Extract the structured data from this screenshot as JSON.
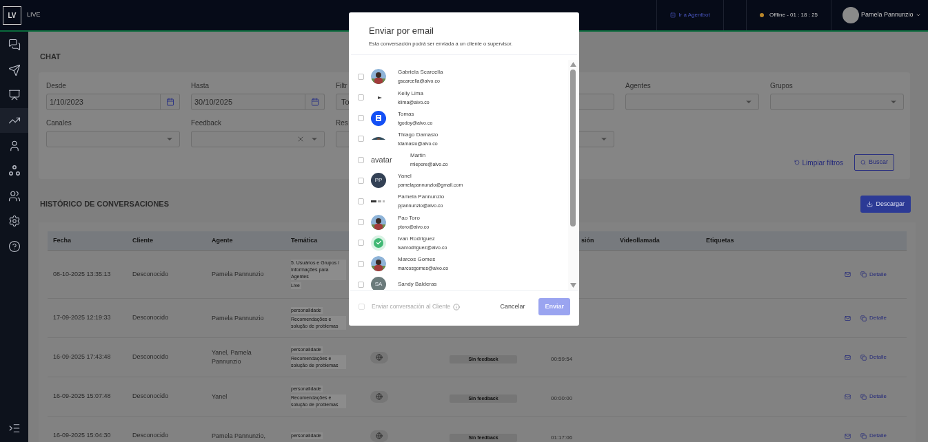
{
  "header": {
    "logo": "LV",
    "product": "LIVE",
    "agentbot_link": "Ir a Agentbot",
    "status": "Offline - 01 : 18 : 25",
    "user": "Pamela Pannunzio"
  },
  "sidebar": {
    "items": [
      {
        "kind": "chats",
        "selected": false
      },
      {
        "kind": "send",
        "selected": false
      },
      {
        "kind": "monitor",
        "selected": false
      },
      {
        "kind": "stats",
        "selected": true
      },
      {
        "kind": "user",
        "selected": false
      },
      {
        "kind": "groups",
        "selected": false
      },
      {
        "kind": "team",
        "selected": false
      },
      {
        "kind": "settings",
        "selected": false
      },
      {
        "kind": "help",
        "selected": false
      }
    ]
  },
  "page_title": "CHAT",
  "filters": [
    {
      "kind": "date",
      "label": "Desde",
      "value": "1/10/2023"
    },
    {
      "kind": "date",
      "label": "Hasta",
      "value": "30/10/2025"
    },
    {
      "kind": "text",
      "label": "Filtr",
      "value": "To"
    },
    {
      "kind": "text"
    },
    {
      "kind": "select",
      "label": "Agentes"
    },
    {
      "kind": "select",
      "label": "Grupos"
    },
    {
      "kind": "select",
      "label": "Canales"
    },
    {
      "kind": "clearable",
      "label": "Feedback"
    },
    {
      "kind": "text",
      "label": "Res"
    },
    {
      "kind": "select"
    }
  ],
  "filter_actions": {
    "clear": "Limpiar filtros",
    "search": "Buscar"
  },
  "history": {
    "title": "HISTÓRICO DE CONVERSACIONES",
    "download": "Descargar",
    "columns": [
      "Fecha",
      "Cliente",
      "Agente",
      "Temática",
      "",
      "",
      "sión",
      "Videollamada",
      "Etiquetas"
    ],
    "rows": [
      {
        "kind": "covered",
        "date": "08-10-2025 13:35:13",
        "client": "Desconocido",
        "agent": "Pamela Pannunzio",
        "topics": [
          "5. Usuários e Grupos / Informações para Agentes",
          "Live"
        ],
        "action": "Detalle"
      },
      {
        "kind": "covered",
        "date": "17-09-2025 12:19:33",
        "client": "Desconocido",
        "agent": "Pamela Pannunzio",
        "topics": [
          "personalidade",
          "Recomendações e solução de problemas"
        ],
        "action": "Detalle"
      },
      {
        "kind": "web",
        "date": "16-09-2025 17:43:48",
        "client": "Desconocido",
        "agent": "Yanel, Pamela Pannunzio",
        "topics": [
          "personalidade",
          "Recomendações e solução de problemas"
        ],
        "feedback": "Sin feedback",
        "duration": "00:59:54",
        "action": "Detalle"
      },
      {
        "kind": "web",
        "date": "16-09-2025 15:07:48",
        "client": "Desconocido",
        "agent": "Yanel",
        "topics": [
          "personalidade",
          "Recomendações e solução de problemas"
        ],
        "feedback": "Sin feedback",
        "duration": "00:00:00",
        "action": "Detalle"
      },
      {
        "kind": "web",
        "date": "16-09-2025 15:04:30",
        "client": "Desconocido",
        "agent": "Pamela Pannunzio,",
        "topics": [
          "personalidade"
        ],
        "feedback": "Sin feedback",
        "duration": "01:17:06",
        "action": "Detalle"
      }
    ]
  },
  "dialog": {
    "title": "Enviar por email",
    "subtitle": "Esta conversación podrá ser enviada a un cliente o supervisor.",
    "recipients": [
      {
        "name": "Gabriela Scarcella",
        "email": "gscarcella@aivo.co",
        "checked": false
      },
      {
        "name": "Kelly Lima",
        "email": "klima@aivo.co",
        "checked": false,
        "avatar": {
          "kind": "broken"
        }
      },
      {
        "name": "Tomas",
        "email": "tgodoy@aivo.co",
        "checked": false,
        "avatar": {
          "kind": "logo"
        }
      },
      {
        "name": "Thiago Damasio",
        "email": "tdamasio@aivo.co",
        "checked": false,
        "avatar": {
          "kind": "partial"
        }
      },
      {
        "name": "Martin",
        "email": "mlepore@aivo.co",
        "checked": false,
        "avatar": {
          "kind": "alt",
          "text": "avatar"
        }
      },
      {
        "name": "Yanel",
        "email": "pamelapannunzio@gmail.com",
        "checked": false,
        "avatar": {
          "kind": "initials",
          "text": "PP",
          "color": "#334155"
        }
      },
      {
        "name": "Pamela Pannunzio",
        "email": "ppannunzio@aivo.co",
        "checked": false,
        "avatar": {
          "kind": "tiny"
        }
      },
      {
        "name": "Pao Toro",
        "email": "ptoro@aivo.co",
        "checked": false
      },
      {
        "name": "Ivan Rodriguez",
        "email": "ivanrodriguez@aivo.co",
        "checked": false,
        "avatar": {
          "kind": "check"
        }
      },
      {
        "name": "Marcos Gomes",
        "email": "marcosgomes@aivo.co",
        "checked": false
      },
      {
        "name": "Sandy Balderas",
        "checked": false,
        "avatar": {
          "kind": "initials",
          "text": "SA",
          "color": "#6b7b7b"
        }
      }
    ],
    "send_to_client": {
      "label": "Enviar conversación al Cliente",
      "checked": false,
      "disabled": true
    },
    "cancel": "Cancelar",
    "send": {
      "label": "Enviar",
      "disabled": true
    }
  }
}
